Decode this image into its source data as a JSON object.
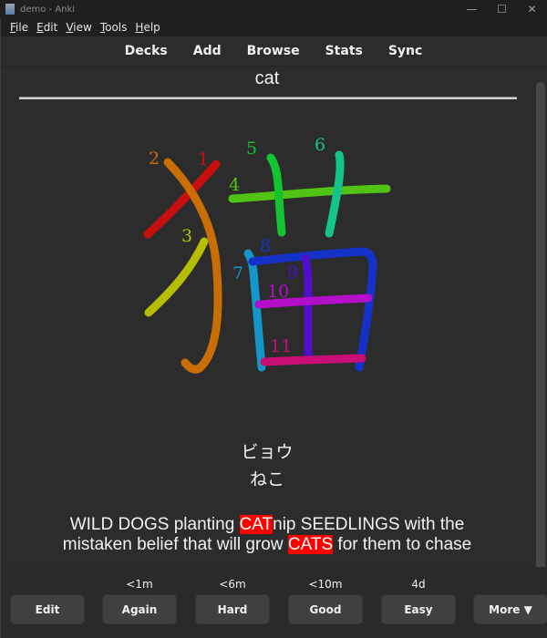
{
  "window": {
    "title": "demo - Anki",
    "app_icon": "anki-icon",
    "controls": {
      "minimize": "—",
      "maximize": "☐",
      "close": "✕"
    }
  },
  "menu": [
    "File",
    "Edit",
    "View",
    "Tools",
    "Help"
  ],
  "toolbar": [
    "Decks",
    "Add",
    "Browse",
    "Stats",
    "Sync"
  ],
  "card": {
    "front": "cat",
    "kanji": "猫",
    "strokes": [
      {
        "n": "1",
        "color": "#c80f0f"
      },
      {
        "n": "2",
        "color": "#c86e05"
      },
      {
        "n": "3",
        "color": "#b4be05"
      },
      {
        "n": "4",
        "color": "#50c314"
      },
      {
        "n": "5",
        "color": "#14c332"
      },
      {
        "n": "6",
        "color": "#14c38c"
      },
      {
        "n": "7",
        "color": "#1496c8"
      },
      {
        "n": "8",
        "color": "#1432c8"
      },
      {
        "n": "9",
        "color": "#500fc8"
      },
      {
        "n": "10",
        "color": "#b40fc8"
      },
      {
        "n": "11",
        "color": "#c80f78"
      }
    ],
    "reading_on": "ビョウ",
    "reading_kun": "ねこ",
    "mnemonic": {
      "line1_a": "WILD DOGS planting ",
      "line1_hl": "CAT",
      "line1_b": "nip SEEDLINGS with the",
      "line2_a": "mistaken belief that will grow ",
      "line2_hl": "CATS",
      "line2_b": " for them to chase"
    },
    "highlight_color": "#ff0000"
  },
  "answer_bar": {
    "edit": "Edit",
    "buttons": [
      {
        "label": "Again",
        "due": "<1m"
      },
      {
        "label": "Hard",
        "due": "<6m"
      },
      {
        "label": "Good",
        "due": "<10m"
      },
      {
        "label": "Easy",
        "due": "4d"
      }
    ],
    "more": "More ▼"
  }
}
